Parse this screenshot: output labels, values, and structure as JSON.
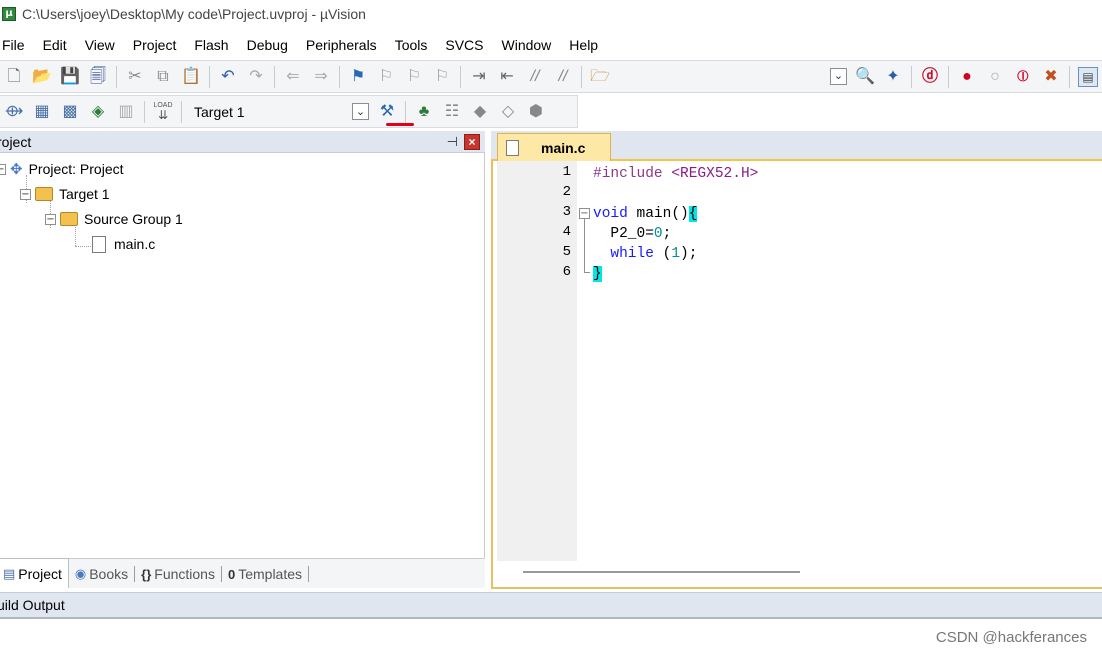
{
  "window": {
    "title": "C:\\Users\\joey\\Desktop\\My code\\Project.uvproj - µVision",
    "app_icon_letter": "μ"
  },
  "menu": [
    "File",
    "Edit",
    "View",
    "Project",
    "Flash",
    "Debug",
    "Peripherals",
    "Tools",
    "SVCS",
    "Window",
    "Help"
  ],
  "toolbar2": {
    "load_label": "LOAD",
    "target": "Target 1"
  },
  "project_panel": {
    "title": "roject",
    "tree": {
      "root": "Project: Project",
      "target": "Target 1",
      "group": "Source Group 1",
      "file": "main.c"
    },
    "tabs": [
      {
        "label": "Project",
        "icon": "project-tab-icon"
      },
      {
        "label": "Books",
        "icon": "books-tab-icon"
      },
      {
        "label": "Functions",
        "icon": "functions-tab-icon",
        "glyph": "{}"
      },
      {
        "label": "Templates",
        "icon": "templates-tab-icon",
        "glyph": "0"
      }
    ]
  },
  "editor": {
    "tab_label": "main.c",
    "line_numbers": [
      "1",
      "2",
      "3",
      "4",
      "5",
      "6"
    ],
    "lines": [
      {
        "parts": [
          {
            "t": "#include ",
            "c": "pre"
          },
          {
            "t": "<REGX52.H>",
            "c": "inc"
          }
        ]
      },
      {
        "parts": []
      },
      {
        "parts": [
          {
            "t": "void",
            "c": "kw"
          },
          {
            "t": " main()",
            "c": ""
          },
          {
            "t": "{",
            "c": "brace"
          }
        ]
      },
      {
        "parts": [
          {
            "t": "  P2_0=",
            "c": ""
          },
          {
            "t": "0",
            "c": "num"
          },
          {
            "t": ";",
            "c": ""
          }
        ]
      },
      {
        "parts": [
          {
            "t": "  ",
            "c": ""
          },
          {
            "t": "while",
            "c": "kw"
          },
          {
            "t": " (",
            "c": ""
          },
          {
            "t": "1",
            "c": "num"
          },
          {
            "t": ");",
            "c": ""
          }
        ]
      },
      {
        "parts": [
          {
            "t": "}",
            "c": "brace"
          }
        ]
      }
    ]
  },
  "build_output": {
    "title": "uild Output"
  },
  "watermark": "CSDN @hackferances",
  "colors": {
    "accent_tab": "#fde8a6",
    "panel_header": "#dfe6f0",
    "keyword": "#1a1aff",
    "preprocessor": "#8b3a8b",
    "number": "#009090",
    "brace_highlight": "#00e5e5"
  }
}
